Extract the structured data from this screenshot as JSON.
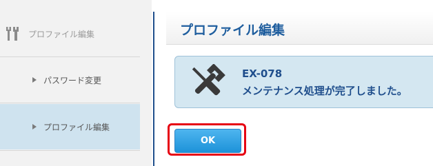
{
  "sidebar": {
    "header_label": "プロファイル編集",
    "header_icon": "tools-icon",
    "items": [
      {
        "label": "パスワード変更",
        "active": false
      },
      {
        "label": "プロファイル編集",
        "active": true
      }
    ]
  },
  "main": {
    "title": "プロファイル編集",
    "message": {
      "icon": "maintenance-tools-icon",
      "code": "EX-078",
      "text": "メンテナンス処理が完了しました。"
    },
    "ok_label": "OK"
  },
  "colors": {
    "accent": "#1f5e9e",
    "message_bg": "#d4e7f1",
    "button": "#2fa3e6",
    "highlight": "#e60012"
  }
}
